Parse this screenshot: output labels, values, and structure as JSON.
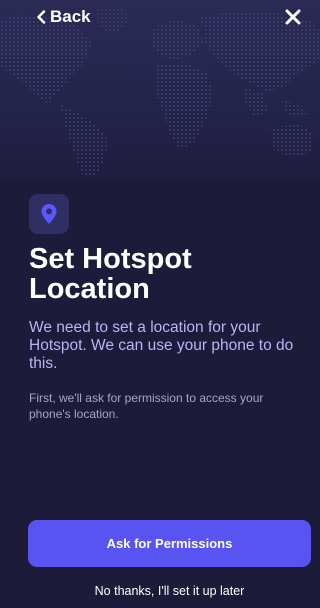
{
  "nav": {
    "back_label": "Back"
  },
  "content": {
    "title": "Set Hotspot Location",
    "description": "We need to set a location for your Hotspot. We can use your phone to do this.",
    "permission_note": "First, we'll ask for permission to access your phone's location."
  },
  "actions": {
    "primary_label": "Ask for Permissions",
    "secondary_label": "No thanks, I'll set it up later"
  },
  "icons": {
    "back": "chevron-left-icon",
    "close": "close-icon",
    "location": "location-pin-icon",
    "background": "world-map"
  },
  "colors": {
    "background": "#1c1b3a",
    "accent": "#5754f2",
    "description_text": "#b7b6f4",
    "pin": "#5a57ff"
  }
}
